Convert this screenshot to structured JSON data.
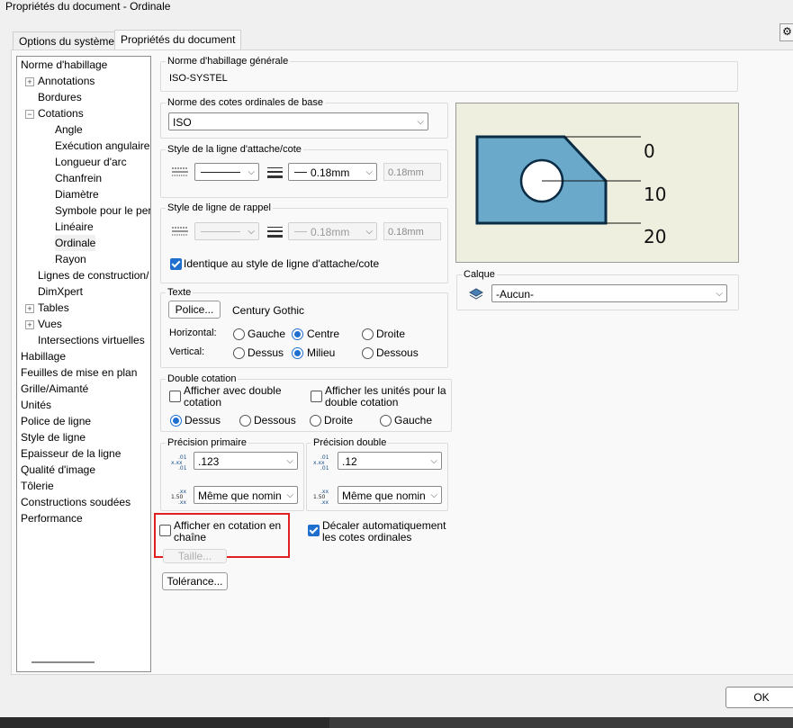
{
  "window": {
    "title": "Propriétés du document - Ordinale"
  },
  "tabs": [
    {
      "label": "Options du système"
    },
    {
      "label": "Propriétés du document"
    }
  ],
  "tree": {
    "items": [
      {
        "label": "Norme d'habillage"
      },
      {
        "label": "Annotations"
      },
      {
        "label": "Bordures"
      },
      {
        "label": "Cotations"
      },
      {
        "label": "Angle"
      },
      {
        "label": "Exécution angulaire"
      },
      {
        "label": "Longueur d'arc"
      },
      {
        "label": "Chanfrein"
      },
      {
        "label": "Diamètre"
      },
      {
        "label": "Symbole pour le per"
      },
      {
        "label": "Linéaire"
      },
      {
        "label": "Ordinale"
      },
      {
        "label": "Rayon"
      },
      {
        "label": "Lignes de construction/"
      },
      {
        "label": "DimXpert"
      },
      {
        "label": "Tables"
      },
      {
        "label": "Vues"
      },
      {
        "label": "Intersections virtuelles"
      },
      {
        "label": "Habillage"
      },
      {
        "label": "Feuilles de mise en plan"
      },
      {
        "label": "Grille/Aimanté"
      },
      {
        "label": "Unités"
      },
      {
        "label": "Police de ligne"
      },
      {
        "label": "Style de ligne"
      },
      {
        "label": "Epaisseur de la ligne"
      },
      {
        "label": "Qualité d'image"
      },
      {
        "label": "Tôlerie"
      },
      {
        "label": "Constructions soudées"
      },
      {
        "label": "Performance"
      }
    ]
  },
  "norme_generale": {
    "label": "Norme d'habillage générale",
    "value": "ISO-SYSTEL"
  },
  "norme_base": {
    "label": "Norme des cotes ordinales de base",
    "value": "ISO"
  },
  "style_attache": {
    "label": "Style de la ligne d'attache/cote",
    "thickness": "0.18mm",
    "custom": "0.18mm"
  },
  "style_rappel": {
    "label": "Style de ligne de rappel",
    "thickness": "0.18mm",
    "custom": "0.18mm",
    "same_label": "Identique au style de ligne d'attache/cote"
  },
  "texte": {
    "label": "Texte",
    "font_button": "Police...",
    "font_name": "Century Gothic",
    "horizontal_label": "Horizontal:",
    "vertical_label": "Vertical:",
    "h_options": [
      "Gauche",
      "Centre",
      "Droite"
    ],
    "v_options": [
      "Dessus",
      "Milieu",
      "Dessous"
    ]
  },
  "double_cotation": {
    "label": "Double cotation",
    "show_label": "Afficher avec double cotation",
    "units_label": "Afficher les unités pour la double cotation",
    "positions": [
      "Dessus",
      "Dessous",
      "Droite",
      "Gauche"
    ]
  },
  "precision_primaire": {
    "label": "Précision primaire",
    "value": ".123",
    "tolerance": "Même que nomin"
  },
  "precision_double": {
    "label": "Précision double",
    "value": ".12",
    "tolerance": "Même que nomin"
  },
  "chain": {
    "label": "Afficher en cotation en chaîne",
    "size_button": "Taille..."
  },
  "offset": {
    "label": "Décaler automatiquement les cotes ordinales"
  },
  "tolerance_button": "Tolérance...",
  "preview": {
    "labels": [
      "0",
      "10",
      "20"
    ],
    "fill": "#6aa9c9"
  },
  "calque": {
    "label": "Calque",
    "value": "-Aucun-"
  },
  "ok_button": "OK"
}
